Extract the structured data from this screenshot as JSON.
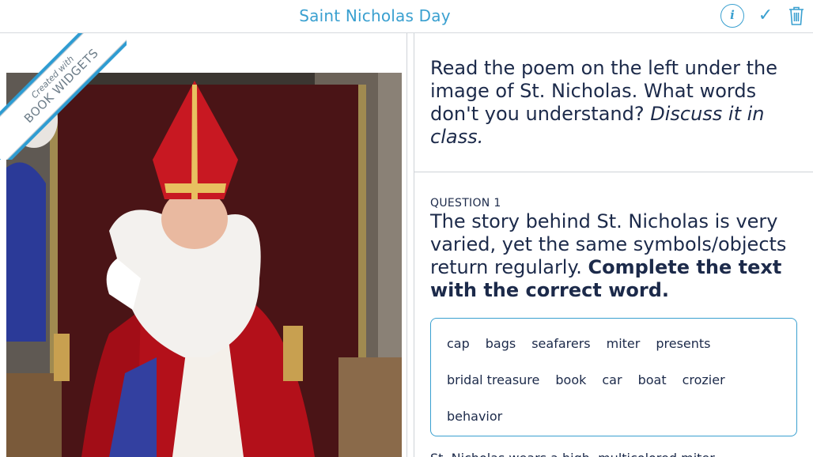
{
  "header": {
    "title": "Saint Nicholas Day",
    "tools": {
      "info_label": "i",
      "check_label": "✓"
    }
  },
  "ribbon": {
    "line1": "Created with",
    "line2": "BOOK WIDGETS"
  },
  "left": {
    "image": {
      "subject": "Saint Nicholas in red miter and robe, with white beard, pointing"
    }
  },
  "right": {
    "instruction": {
      "plain": "Read the poem on the left under the image of St. Nicholas. What words don't you understand? ",
      "emphasis": "Discuss it in class."
    },
    "question": {
      "label": "QUESTION 1",
      "text": "The story behind St. Nicholas is very varied, yet the same symbols/objects return regularly. ",
      "bold": "Complete the text with the correct word."
    },
    "words": [
      "cap",
      "bags",
      "seafarers",
      "miter",
      "presents",
      "bridal treasure",
      "book",
      "car",
      "boat",
      "crozier",
      "behavior"
    ],
    "next_text": "St. Nicholas wears a high, multicolored miter"
  },
  "colors": {
    "accent": "#3aa0d0",
    "text": "#1c2a4a",
    "ribbon_border": "#2e9cd2"
  }
}
